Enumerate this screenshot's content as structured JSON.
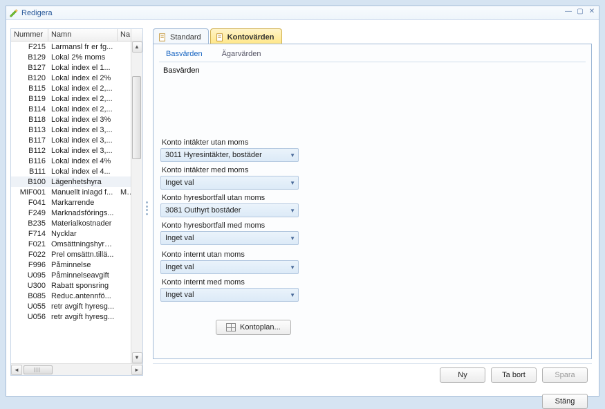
{
  "window": {
    "title": "Redigera"
  },
  "grid": {
    "headers": [
      "Nummer",
      "Namn",
      "Na"
    ],
    "rows": [
      {
        "num": "F215",
        "name": "Larmansl fr er fg...",
        "extra": ""
      },
      {
        "num": "B129",
        "name": "Lokal 2% moms",
        "extra": ""
      },
      {
        "num": "B127",
        "name": "Lokal index el 1...",
        "extra": ""
      },
      {
        "num": "B120",
        "name": "Lokal index el 2%",
        "extra": ""
      },
      {
        "num": "B115",
        "name": "Lokal index el 2,...",
        "extra": ""
      },
      {
        "num": "B119",
        "name": "Lokal index el 2,...",
        "extra": ""
      },
      {
        "num": "B114",
        "name": "Lokal index el 2,...",
        "extra": ""
      },
      {
        "num": "B118",
        "name": "Lokal index el 3%",
        "extra": ""
      },
      {
        "num": "B113",
        "name": "Lokal index el 3,...",
        "extra": ""
      },
      {
        "num": "B117",
        "name": "Lokal index el 3,...",
        "extra": ""
      },
      {
        "num": "B112",
        "name": "Lokal index el 3,...",
        "extra": ""
      },
      {
        "num": "B116",
        "name": "Lokal index el 4%",
        "extra": ""
      },
      {
        "num": "B111",
        "name": "Lokal index el 4...",
        "extra": ""
      },
      {
        "num": "B100",
        "name": "Lägenhetshyra",
        "extra": "",
        "selected": true
      },
      {
        "num": "MIF001",
        "name": "Manuellt inlagd f...",
        "extra": "Ma"
      },
      {
        "num": "F041",
        "name": "Markarrende",
        "extra": ""
      },
      {
        "num": "F249",
        "name": "Marknadsförings...",
        "extra": ""
      },
      {
        "num": "B235",
        "name": "Materialkostnader",
        "extra": ""
      },
      {
        "num": "F714",
        "name": "Nycklar",
        "extra": ""
      },
      {
        "num": "F021",
        "name": "Omsättningshyra...",
        "extra": ""
      },
      {
        "num": "F022",
        "name": "Prel omsättn.tillä...",
        "extra": ""
      },
      {
        "num": "F996",
        "name": "Påminnelse",
        "extra": ""
      },
      {
        "num": "U095",
        "name": "Påminnelseavgift",
        "extra": ""
      },
      {
        "num": "U300",
        "name": "Rabatt sponsring",
        "extra": ""
      },
      {
        "num": "B085",
        "name": "Reduc.antennfö...",
        "extra": ""
      },
      {
        "num": "U055",
        "name": "retr avgift hyresg...",
        "extra": ""
      },
      {
        "num": "U056",
        "name": "retr avgift hyresg...",
        "extra": ""
      }
    ]
  },
  "outerTabs": {
    "standard": "Standard",
    "kontovarden": "Kontovärden"
  },
  "innerTabs": {
    "basvarden": "Basvärden",
    "agarvarden": "Ägarvärden"
  },
  "section": {
    "title": "Basvärden"
  },
  "fields": {
    "f1": {
      "label": "Konto intäkter utan moms",
      "value": "3011 Hyresintäkter, bostäder"
    },
    "f2": {
      "label": "Konto intäkter med moms",
      "value": "Inget val"
    },
    "f3": {
      "label": "Konto hyresbortfall utan moms",
      "value": "3081 Outhyrt bostäder"
    },
    "f4": {
      "label": "Konto hyresbortfall med moms",
      "value": "Inget val"
    },
    "f5": {
      "label": "Konto internt utan moms",
      "value": "Inget val"
    },
    "f6": {
      "label": "Konto internt med moms",
      "value": "Inget val"
    }
  },
  "buttons": {
    "kontoplan": "Kontoplan...",
    "ny": "Ny",
    "tabort": "Ta bort",
    "spara": "Spara",
    "stang": "Stäng"
  }
}
